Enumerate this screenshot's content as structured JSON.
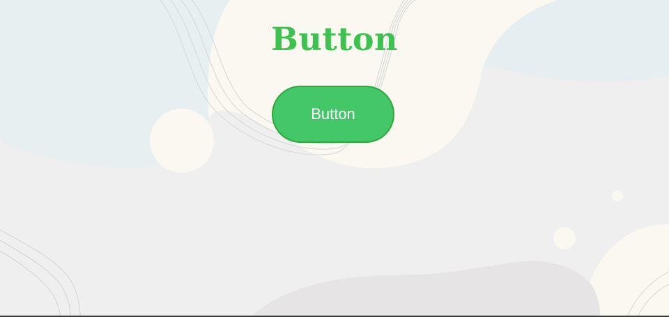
{
  "page": {
    "title": "Button"
  },
  "button": {
    "label": "Button"
  },
  "colors": {
    "accent": "#3ec24f",
    "button_fill": "#44c768",
    "button_border": "#2ea83a",
    "button_text": "#ffffff",
    "background": "#efefef"
  }
}
